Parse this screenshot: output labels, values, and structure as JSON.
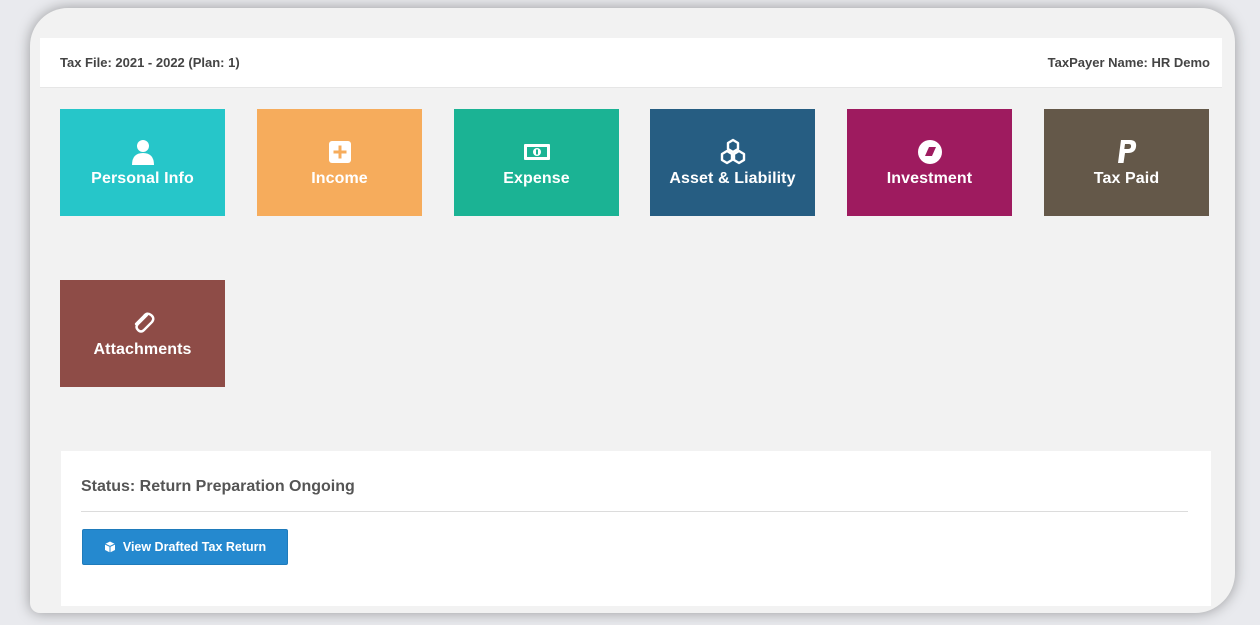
{
  "header": {
    "tax_file": "Tax File: 2021 - 2022 (Plan: 1)",
    "taxpayer": "TaxPayer Name: HR Demo"
  },
  "tiles": [
    {
      "label": "Personal Info",
      "icon": "user-icon",
      "color": "#26c6c9"
    },
    {
      "label": "Income",
      "icon": "plus-square-icon",
      "color": "#f6ac5c"
    },
    {
      "label": "Expense",
      "icon": "money-bill-icon",
      "color": "#1bb394"
    },
    {
      "label": "Asset & Liability",
      "icon": "cubes-icon",
      "color": "#265d82"
    },
    {
      "label": "Investment",
      "icon": "investment-icon",
      "color": "#9e1b5f"
    },
    {
      "label": "Tax Paid",
      "icon": "paypal-icon",
      "color": "#645849"
    },
    {
      "label": "Attachments",
      "icon": "paperclip-icon",
      "color": "#8e4c47"
    }
  ],
  "status": {
    "text": "Status: Return Preparation Ongoing",
    "button_label": "View Drafted Tax Return",
    "button_icon": "cube-icon",
    "button_color": "#2589cf"
  }
}
